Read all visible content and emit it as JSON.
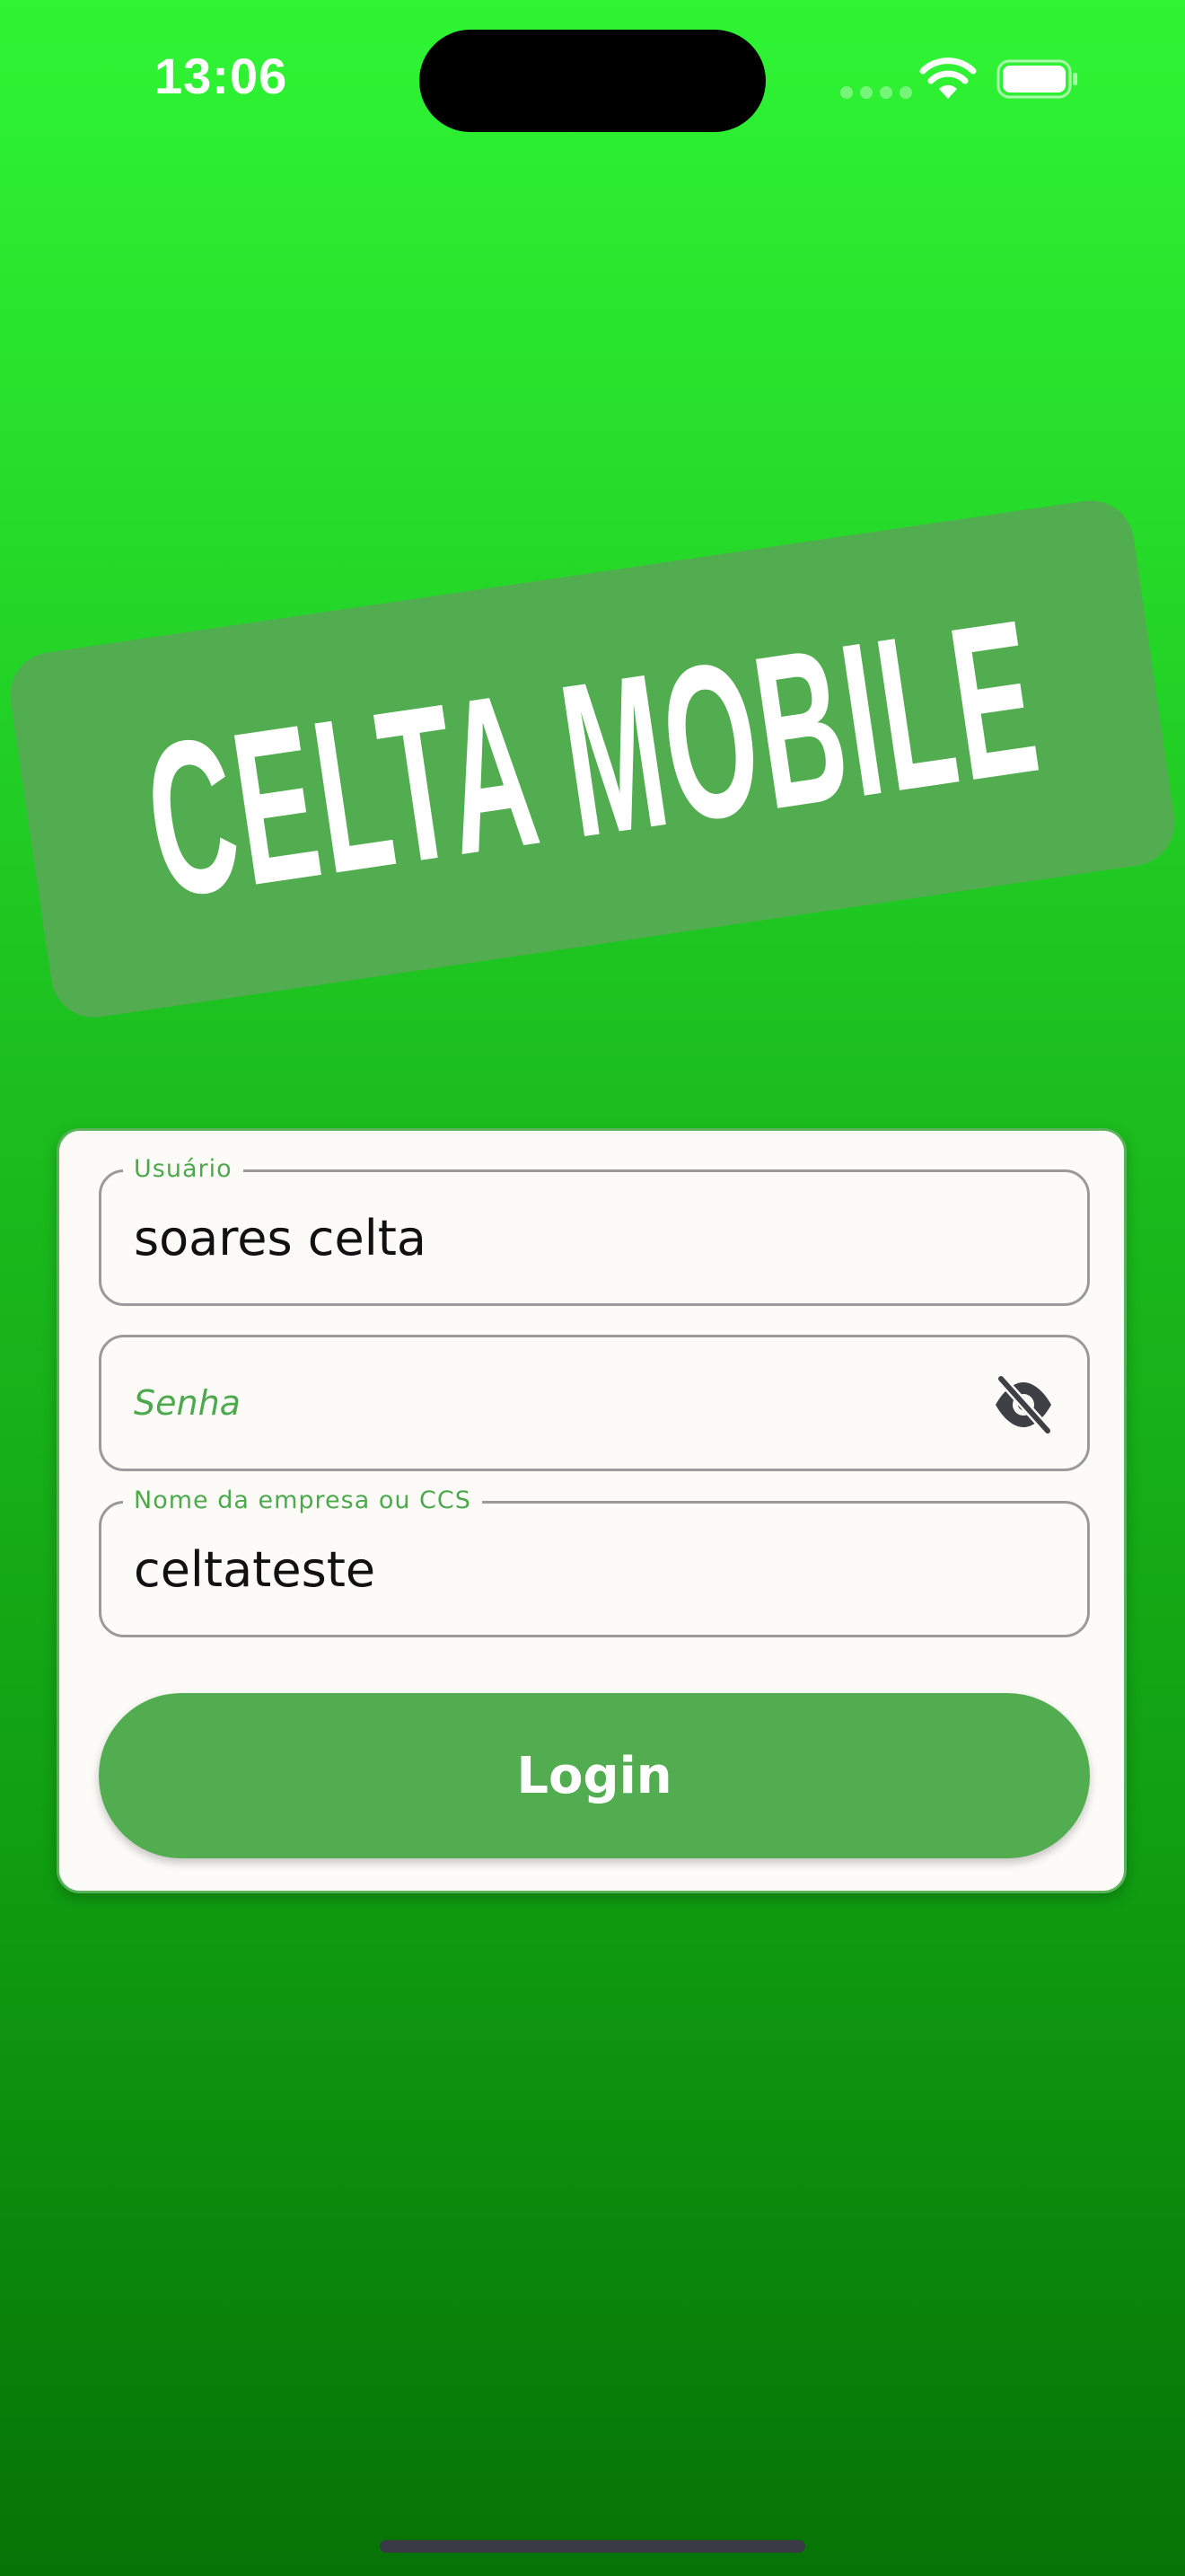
{
  "status_bar": {
    "time": "13:06",
    "icons": [
      "cellular-signal-icon",
      "wifi-icon",
      "battery-icon"
    ]
  },
  "logo": {
    "text": "CELTA MOBILE",
    "banner_color": "#52ad50"
  },
  "form": {
    "username": {
      "label": "Usuário",
      "value": "soares celta"
    },
    "password": {
      "placeholder": "Senha",
      "visibility_icon": "eye-off-icon"
    },
    "company": {
      "label": "Nome da empresa ou CCS",
      "value": "celtateste"
    },
    "login_button": "Login"
  },
  "colors": {
    "accent": "#52ad50",
    "label": "#4ea94e",
    "background_top": "#2ff534",
    "background_bottom": "#067306",
    "card": "#fcfbf7"
  }
}
